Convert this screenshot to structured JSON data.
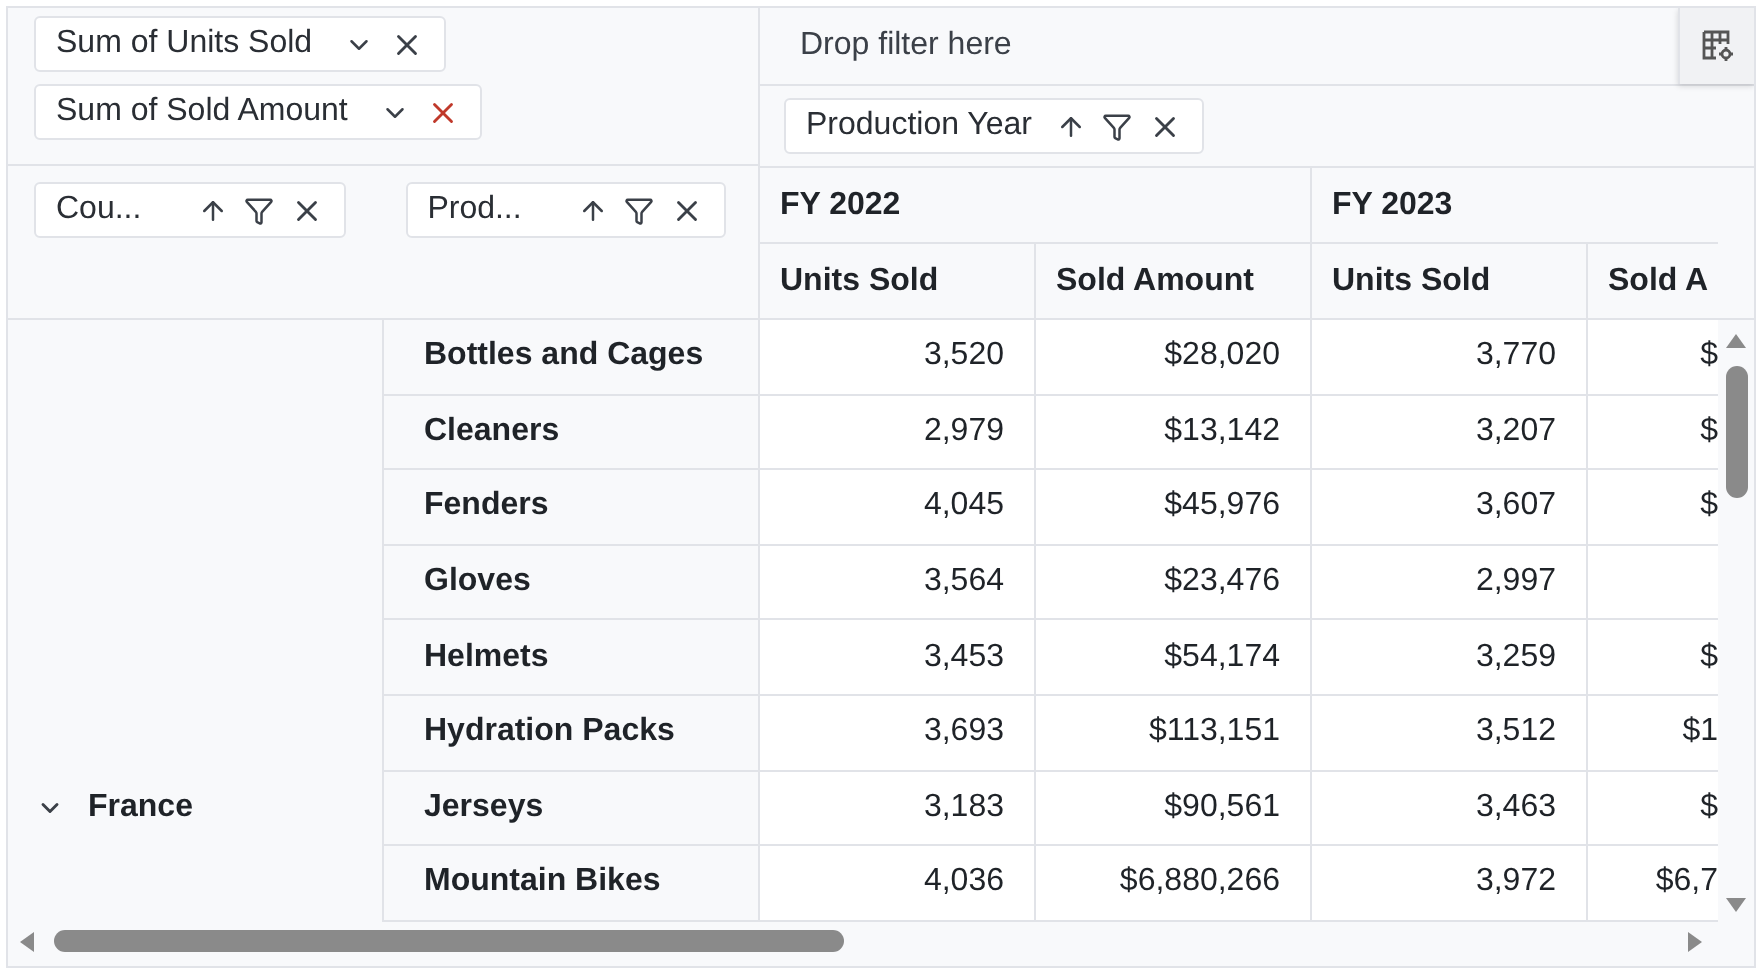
{
  "value_fields": [
    {
      "label": "Sum of Units Sold",
      "remove_highlighted": false
    },
    {
      "label": "Sum of Sold Amount",
      "remove_highlighted": true
    }
  ],
  "filter_area": {
    "placeholder": "Drop filter here"
  },
  "column_fields": [
    {
      "label": "Production Year"
    }
  ],
  "row_fields": [
    {
      "label": "Cou..."
    },
    {
      "label": "Prod..."
    }
  ],
  "column_headers": [
    {
      "label": "FY 2022",
      "measures": [
        "Units Sold",
        "Sold Amount"
      ]
    },
    {
      "label": "FY 2023",
      "measures": [
        "Units Sold",
        "Sold A"
      ]
    }
  ],
  "row_groups": [
    {
      "label": "France",
      "expanded": true,
      "rows": [
        {
          "label": "Bottles and Cages",
          "cells": [
            "3,520",
            "$28,020",
            "3,770",
            "$"
          ]
        },
        {
          "label": "Cleaners",
          "cells": [
            "2,979",
            "$13,142",
            "3,207",
            "$"
          ]
        },
        {
          "label": "Fenders",
          "cells": [
            "4,045",
            "$45,976",
            "3,607",
            "$"
          ]
        },
        {
          "label": "Gloves",
          "cells": [
            "3,564",
            "$23,476",
            "2,997",
            null
          ]
        },
        {
          "label": "Helmets",
          "cells": [
            "3,453",
            "$54,174",
            "3,259",
            "$"
          ]
        },
        {
          "label": "Hydration Packs",
          "cells": [
            "3,693",
            "$113,151",
            "3,512",
            "$1"
          ]
        },
        {
          "label": "Jerseys",
          "cells": [
            "3,183",
            "$90,561",
            "3,463",
            "$"
          ]
        },
        {
          "label": "Mountain Bikes",
          "cells": [
            "4,036",
            "$6,880,266",
            "3,972",
            "$6,7"
          ]
        }
      ]
    }
  ]
}
